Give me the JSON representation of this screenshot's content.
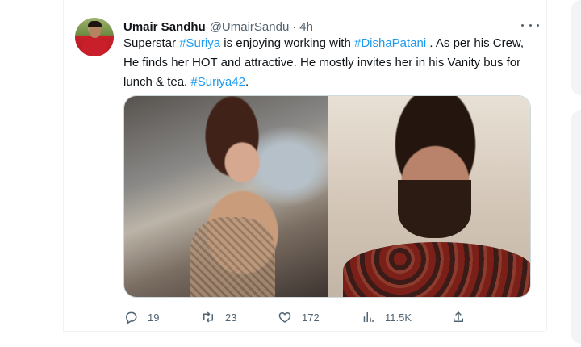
{
  "tweet": {
    "author_name": "Umair Sandhu",
    "handle": "@UmairSandu",
    "separator": "·",
    "time": "4h",
    "text_parts": [
      {
        "text": "Superstar ",
        "hashtag": false
      },
      {
        "text": "#Suriya",
        "hashtag": true
      },
      {
        "text": " is enjoying working with ",
        "hashtag": false
      },
      {
        "text": "#DishaPatani",
        "hashtag": true
      },
      {
        "text": " . As per his Crew, He finds her HOT and attractive. He mostly invites her in his Vanity bus for lunch & tea. ",
        "hashtag": false
      },
      {
        "text": "#Suriya42",
        "hashtag": true
      },
      {
        "text": ".",
        "hashtag": false
      }
    ]
  },
  "actions": {
    "reply_count": "19",
    "retweet_count": "23",
    "like_count": "172",
    "views_count": "11.5K"
  },
  "icons": {
    "more": "more-horizontal-icon",
    "reply": "reply-icon",
    "retweet": "retweet-icon",
    "like": "heart-icon",
    "views": "views-icon",
    "share": "share-icon"
  },
  "colors": {
    "hashtag": "#1d9bf0",
    "secondary_text": "#536471",
    "primary_text": "#0f1419"
  }
}
